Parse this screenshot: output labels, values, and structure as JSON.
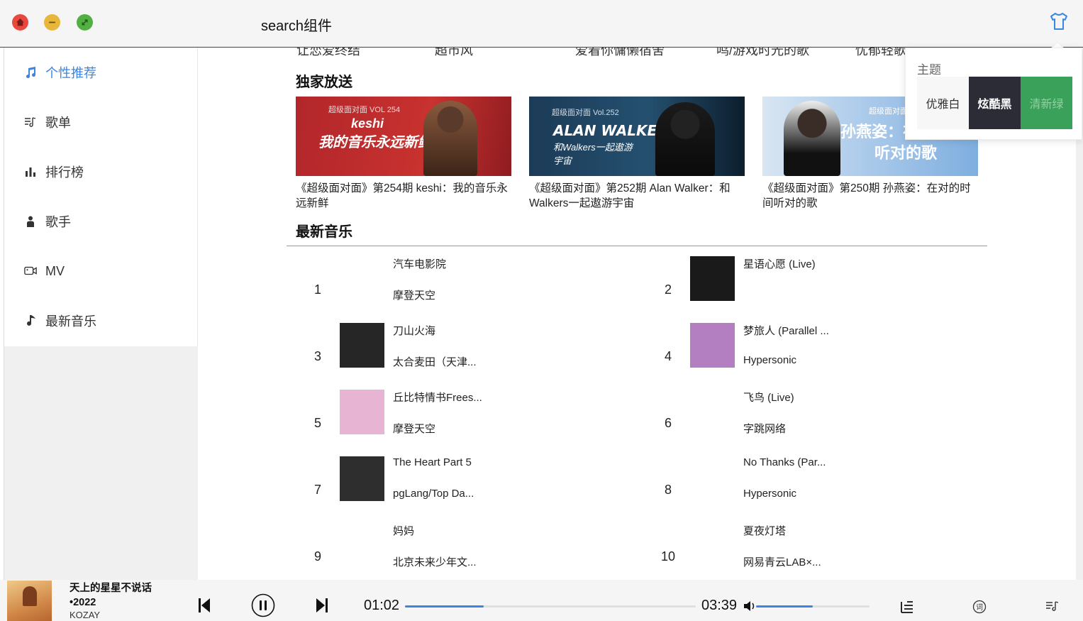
{
  "window": {
    "title": "search组件"
  },
  "sidebar": {
    "items": [
      {
        "label": "个性推荐",
        "icon": "music-note-icon",
        "active": true
      },
      {
        "label": "歌单",
        "icon": "playlist-icon",
        "active": false
      },
      {
        "label": "排行榜",
        "icon": "bar-chart-icon",
        "active": false
      },
      {
        "label": "歌手",
        "icon": "person-icon",
        "active": false
      },
      {
        "label": "MV",
        "icon": "video-camera-icon",
        "active": false
      },
      {
        "label": "最新音乐",
        "icon": "music-note-icon",
        "active": false
      }
    ]
  },
  "main": {
    "cut_row": [
      "让恋爱终结",
      "超市风",
      "爱着你慵懒宿舍",
      "鸣/游戏时光的歌",
      "忧郁轻歌"
    ],
    "exclusive_title": "独家放送",
    "exclusive": [
      {
        "caption": "《超级面对面》第254期 keshi：我的音乐永远新鲜",
        "banner_small": "超级面对面 VOL 254",
        "banner_big": "我的音乐永远新鲜",
        "banner_name": "keshi",
        "bg": "#b8292b"
      },
      {
        "caption": "《超级面对面》第252期 Alan Walker：和Walkers一起遨游宇宙",
        "banner_small": "超级面对面 Vol.252",
        "banner_big": "ALAN WALKER",
        "banner_name": "和Walkers一起遨游宇宙",
        "bg": "#1d3d5a"
      },
      {
        "caption": "《超级面对面》第250期 孙燕姿：在对的时间听对的歌",
        "banner_small": "超级面对面",
        "banner_big": "孙燕姿：在",
        "banner_name": "听对的歌",
        "bg": "#9fc3e6"
      }
    ],
    "newmusic_title": "最新音乐",
    "songs": [
      {
        "num": "1",
        "name": "汽车电影院",
        "artist": "摩登天空",
        "cover": ""
      },
      {
        "num": "2",
        "name": "星语心愿 (Live)",
        "artist": "",
        "cover": "#1a1a1a"
      },
      {
        "num": "3",
        "name": "刀山火海",
        "artist": "太合麦田（天津...",
        "cover": "#262626"
      },
      {
        "num": "4",
        "name": "梦旅人 (Parallel ...",
        "artist": "Hypersonic",
        "cover": "#b47fc0"
      },
      {
        "num": "5",
        "name": "丘比特情书Frees...",
        "artist": "摩登天空",
        "cover": "#e7b5d3"
      },
      {
        "num": "6",
        "name": "飞鸟 (Live)",
        "artist": "字跳网络",
        "cover": ""
      },
      {
        "num": "7",
        "name": "The Heart Part 5",
        "artist": "pgLang/Top Da...",
        "cover": "#2e2e2e"
      },
      {
        "num": "8",
        "name": "No Thanks (Par...",
        "artist": "Hypersonic",
        "cover": ""
      },
      {
        "num": "9",
        "name": "妈妈",
        "artist": "北京未来少年文...",
        "cover": ""
      },
      {
        "num": "10",
        "name": "夏夜灯塔",
        "artist": "网易青云LAB×...",
        "cover": ""
      }
    ]
  },
  "theme_popover": {
    "title": "主题",
    "options": [
      "优雅白",
      "炫酷黑",
      "清新绿"
    ]
  },
  "player": {
    "title": "天上的星星不说话•2022",
    "artist": "KOZAY",
    "current_time": "01:02",
    "total_time": "03:39",
    "progress": 0.27,
    "volume": 0.5,
    "accent": "#3a86e0"
  }
}
